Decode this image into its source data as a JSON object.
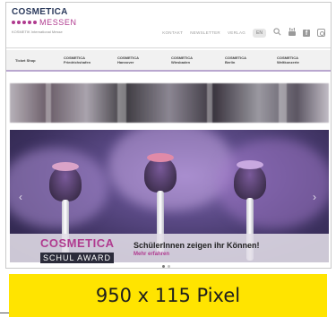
{
  "logo": {
    "line1": "COSMETICA",
    "line2": "MESSEN",
    "subtitle": "KOSMETIK International Messe"
  },
  "topnav": {
    "items": [
      "KONTAKT",
      "NEWSLETTER",
      "VERLAG"
    ],
    "language": "EN",
    "icons": [
      "search-icon",
      "youtube-icon",
      "facebook-icon",
      "instagram-icon"
    ]
  },
  "menu": {
    "items": [
      {
        "line1": "Ticket Shop",
        "line2": ""
      },
      {
        "line1": "COSMETICA",
        "line2": "Friedrichshafen"
      },
      {
        "line1": "COSMETICA",
        "line2": "Hannover"
      },
      {
        "line1": "COSMETICA",
        "line2": "Wiesbaden"
      },
      {
        "line1": "COSMETICA",
        "line2": "Berlin"
      },
      {
        "line1": "COSMETICA",
        "line2": "Weltkonzerte"
      }
    ]
  },
  "hero": {
    "logo_main": "COSMETICA",
    "logo_sub": "SCHUL AWARD",
    "headline": "SchülerInnen zeigen ihr Können!",
    "more_link": "Mehr erfahren",
    "prev_arrow": "‹",
    "next_arrow": "›"
  },
  "ad": {
    "label": "950 x 115 Pixel",
    "color": "#ffe400"
  }
}
